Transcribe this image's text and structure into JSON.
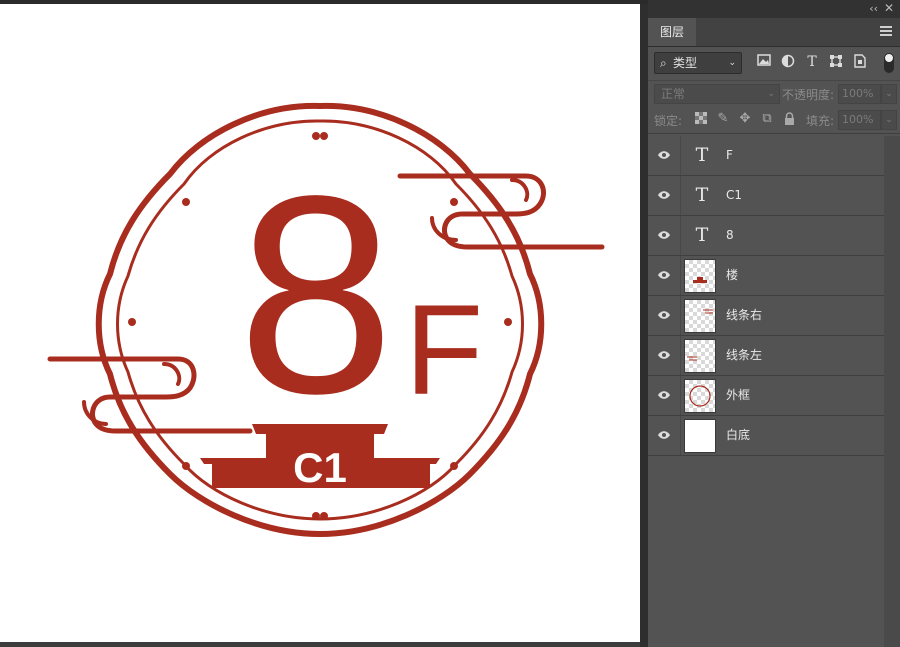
{
  "artwork": {
    "big_number": "8",
    "floor_letter": "F",
    "badge_text": "C1",
    "brand_color": "#A82D1F"
  },
  "panel": {
    "collapse_glyph": "‹‹",
    "close_glyph": "✕",
    "tab_label": "图层",
    "filter": {
      "search_glyph": "⌕",
      "kind_label": "类型",
      "icons": [
        "image-filter-icon",
        "adjustment-filter-icon",
        "type-filter-icon",
        "shape-filter-icon",
        "smart-object-filter-icon"
      ],
      "type_glyph": "T"
    },
    "blend_mode": "正常",
    "opacity_label": "不透明度:",
    "opacity_value": "100%",
    "lock_label": "锁定:",
    "lock_icons": [
      "lock-transparent-icon",
      "lock-image-icon",
      "lock-position-icon",
      "lock-artboard-icon",
      "lock-all-icon"
    ],
    "fill_label": "填充:",
    "fill_value": "100%"
  },
  "layers": [
    {
      "name": "F",
      "kind": "text",
      "glyph": "T"
    },
    {
      "name": "C1",
      "kind": "text",
      "glyph": "T"
    },
    {
      "name": "8",
      "kind": "text",
      "glyph": "T"
    },
    {
      "name": "楼",
      "kind": "raster"
    },
    {
      "name": "线条右",
      "kind": "raster"
    },
    {
      "name": "线条左",
      "kind": "raster"
    },
    {
      "name": "外框",
      "kind": "raster"
    },
    {
      "name": "白底",
      "kind": "fill"
    }
  ]
}
